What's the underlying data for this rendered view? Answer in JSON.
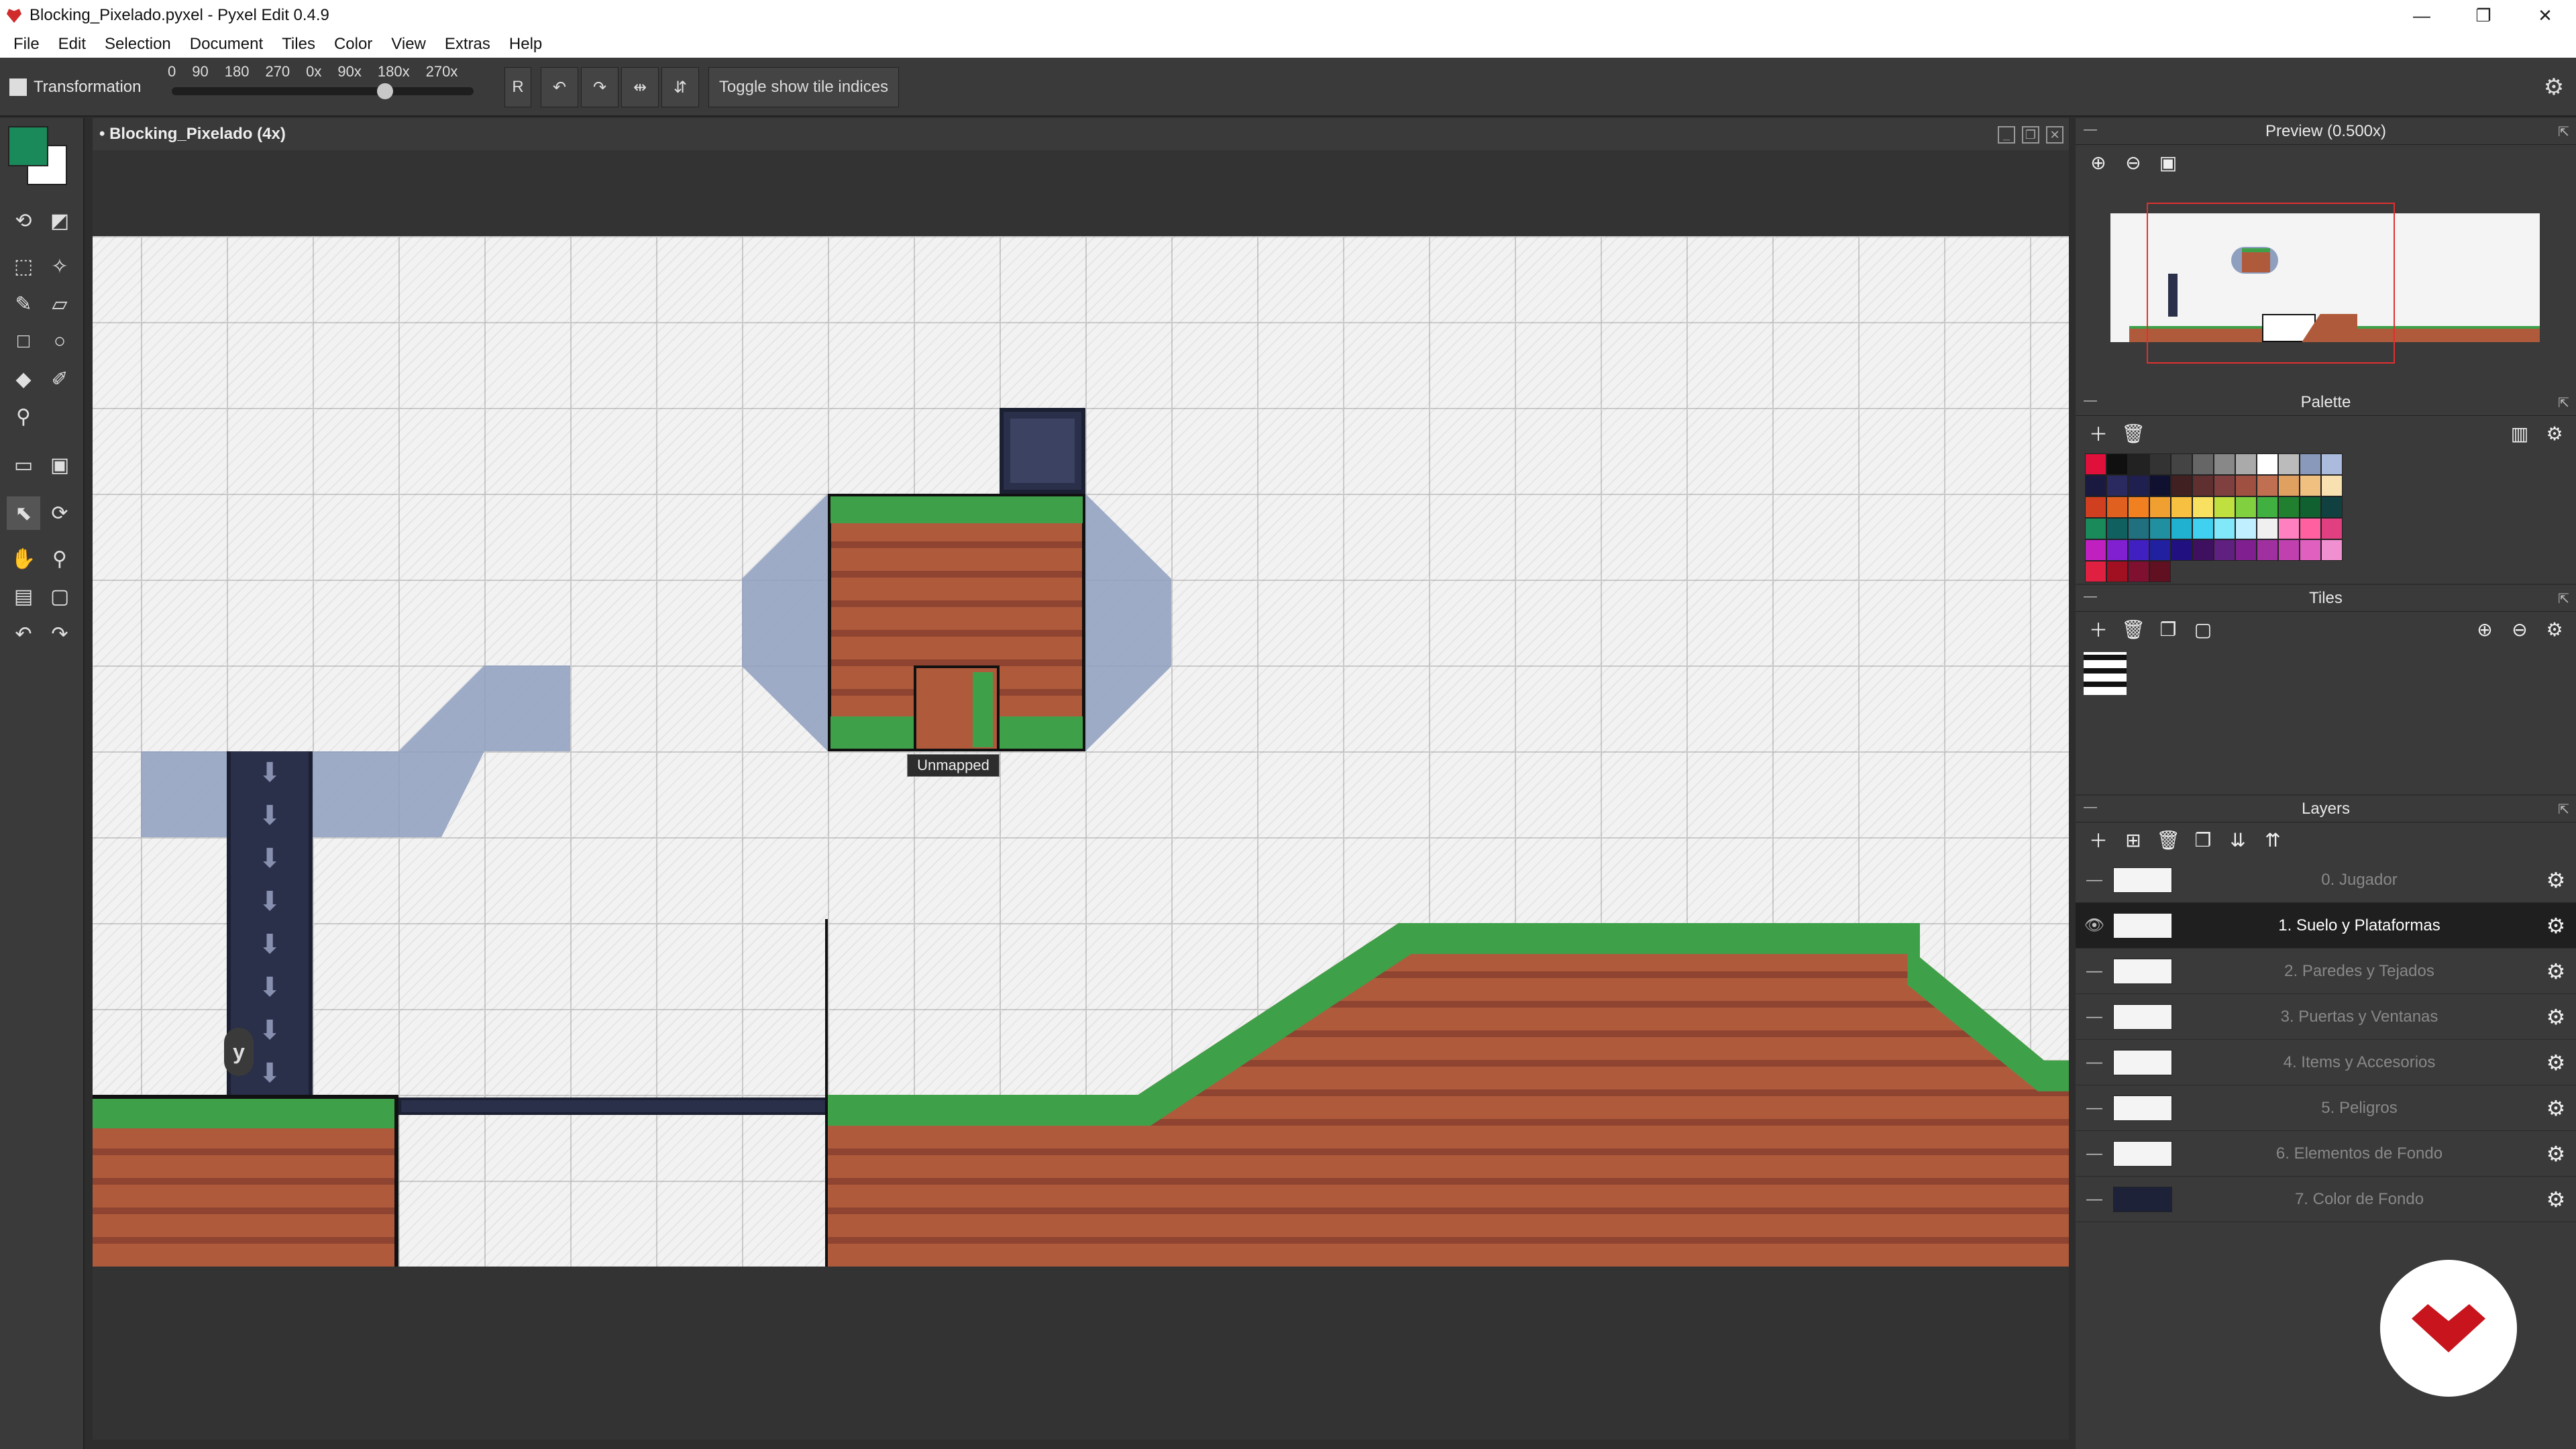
{
  "window": {
    "title": "Blocking_Pixelado.pyxel - Pyxel Edit 0.4.9",
    "controls": [
      "—",
      "❐",
      "✕"
    ]
  },
  "menu": [
    "File",
    "Edit",
    "Selection",
    "Document",
    "Tiles",
    "Color",
    "View",
    "Extras",
    "Help"
  ],
  "tool_options": {
    "tool_name": "Transformation",
    "rotation_labels": [
      "0",
      "90",
      "180",
      "270",
      "0x",
      "90x",
      "180x",
      "270x"
    ],
    "rotation_slider_value": "270",
    "r_label": "R",
    "toggle_button_label": "Toggle show tile indices"
  },
  "document": {
    "title": "• Blocking_Pixelado  (4x)",
    "tooltip": "Unmapped",
    "player_marker": "y"
  },
  "panels": {
    "preview": {
      "title": "Preview (0.500x)"
    },
    "palette": {
      "title": "Palette",
      "colors": [
        "#e0103c",
        "#101010",
        "#222222",
        "#333333",
        "#444444",
        "#666666",
        "#888888",
        "#aaaaaa",
        "#ffffff",
        "#bbbbbb",
        "#8899bb",
        "#aabbdd",
        "#1a1a40",
        "#2a2a60",
        "#202050",
        "#101030",
        "#402020",
        "#603030",
        "#804040",
        "#a05040",
        "#c07050",
        "#e0a060",
        "#f0c080",
        "#f8e0b0",
        "#d04020",
        "#e06020",
        "#f08020",
        "#f0a030",
        "#f8c040",
        "#f8e060",
        "#c0e040",
        "#80d040",
        "#40b040",
        "#208030",
        "#106030",
        "#104040",
        "#1a8a5a",
        "#106060",
        "#207080",
        "#2090a0",
        "#20b0d0",
        "#40d0f0",
        "#80e8f8",
        "#c0f0ff",
        "#f0f0f0",
        "#ff80c0",
        "#ff60a0",
        "#e04080",
        "#c020c0",
        "#8020d0",
        "#4020c0",
        "#2020a0",
        "#201080",
        "#401060",
        "#602080",
        "#802090",
        "#a030a0",
        "#c040b0",
        "#e060c0",
        "#f090d0",
        "#e02040",
        "#a01020",
        "#801030",
        "#601020"
      ]
    },
    "tiles": {
      "title": "Tiles"
    },
    "layers": {
      "title": "Layers",
      "items": [
        {
          "name": "0. Jugador",
          "visible": false,
          "active": false
        },
        {
          "name": "1. Suelo y Plataformas",
          "visible": true,
          "active": true
        },
        {
          "name": "2. Paredes y Tejados",
          "visible": false,
          "active": false
        },
        {
          "name": "3. Puertas y Ventanas",
          "visible": false,
          "active": false
        },
        {
          "name": "4. Items y Accesorios",
          "visible": false,
          "active": false
        },
        {
          "name": "5. Peligros",
          "visible": false,
          "active": false
        },
        {
          "name": "6. Elementos de Fondo",
          "visible": false,
          "active": false
        },
        {
          "name": "7. Color de Fondo",
          "visible": false,
          "active": false
        }
      ]
    }
  }
}
